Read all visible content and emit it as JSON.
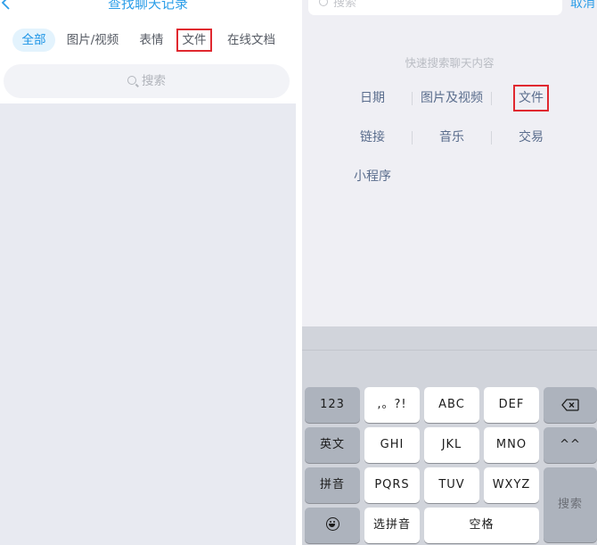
{
  "left_panel": {
    "title": "查找聊天记录",
    "tabs": [
      "全部",
      "图片/视频",
      "表情",
      "文件",
      "在线文档"
    ],
    "search_placeholder": "搜索"
  },
  "right_panel": {
    "search_placeholder": "搜索",
    "cancel_label": "取消",
    "hint": "快速搜索聊天内容",
    "categories": [
      "日期",
      "图片及视频",
      "文件",
      "链接",
      "音乐",
      "交易",
      "小程序"
    ]
  },
  "keyboard": {
    "row1": [
      "123",
      ",。?!",
      "ABC",
      "DEF"
    ],
    "row2": [
      "英文",
      "GHI",
      "JKL",
      "MNO",
      "^^"
    ],
    "row3": [
      "拼音",
      "PQRS",
      "TUV",
      "WXYZ"
    ],
    "row4": [
      "选拼音",
      "空格"
    ],
    "search_key": "搜索",
    "icons": [
      "backspace-icon",
      "emoji-icon"
    ]
  },
  "colors": {
    "accent": "#2d9ee8",
    "highlight_box": "#e0282f",
    "category_text": "#5a6d8d"
  }
}
